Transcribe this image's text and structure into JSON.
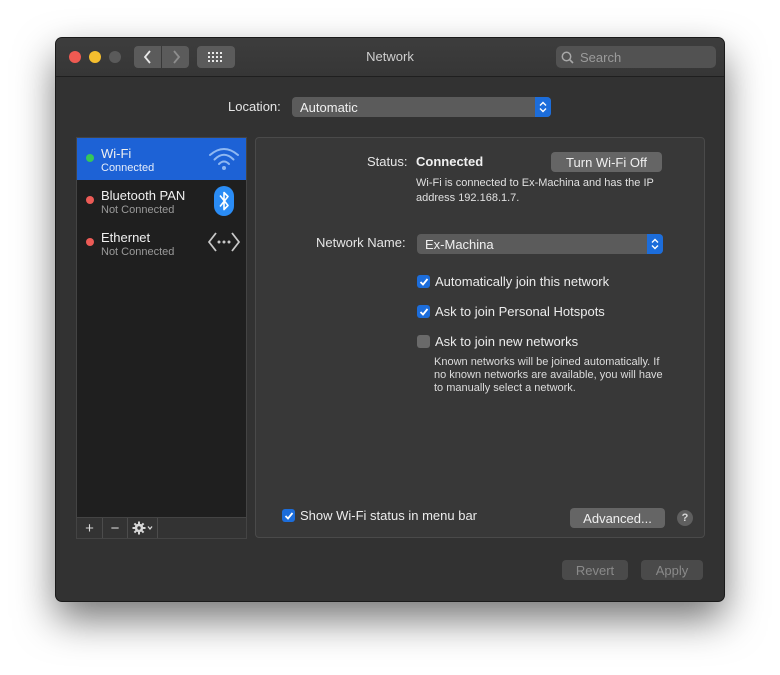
{
  "window": {
    "title": "Network"
  },
  "toolbar": {
    "back_icon": "chevron-left",
    "forward_icon": "chevron-right",
    "grid_icon": "show-all-grid"
  },
  "search": {
    "placeholder": "Search",
    "value": ""
  },
  "location": {
    "label": "Location:",
    "value": "Automatic"
  },
  "services": [
    {
      "name": "Wi-Fi",
      "status": "Connected",
      "status_color": "#35c759",
      "icon": "wifi-icon",
      "selected": true
    },
    {
      "name": "Bluetooth PAN",
      "status": "Not Connected",
      "status_color": "#ec5b56",
      "icon": "bluetooth-icon",
      "selected": false
    },
    {
      "name": "Ethernet",
      "status": "Not Connected",
      "status_color": "#ec5b56",
      "icon": "ethernet-icon",
      "selected": false
    }
  ],
  "sidebar_toolbar": {
    "add": "+",
    "remove": "−",
    "actions_icon": "gear-icon"
  },
  "detail": {
    "status_label": "Status:",
    "status_value": "Connected",
    "turn_off_button": "Turn Wi-Fi Off",
    "status_description": "Wi-Fi is connected to Ex-Machina and has the IP address 192.168.1.7.",
    "network_name_label": "Network Name:",
    "network_name_value": "Ex-Machina",
    "auto_join": {
      "label": "Automatically join this network",
      "checked": true
    },
    "ask_hotspots": {
      "label": "Ask to join Personal Hotspots",
      "checked": true
    },
    "ask_new": {
      "label": "Ask to join new networks",
      "checked": false
    },
    "ask_new_hint": "Known networks will be joined automatically. If no known networks are available, you will have to manually select a network.",
    "show_status": {
      "label": "Show Wi-Fi status in menu bar",
      "checked": true
    },
    "advanced_button": "Advanced...",
    "help": "?"
  },
  "footer": {
    "revert": "Revert",
    "apply": "Apply"
  },
  "colors": {
    "accent": "#1c6ddb",
    "selection": "#1d62d6",
    "window_bg": "#323232"
  }
}
